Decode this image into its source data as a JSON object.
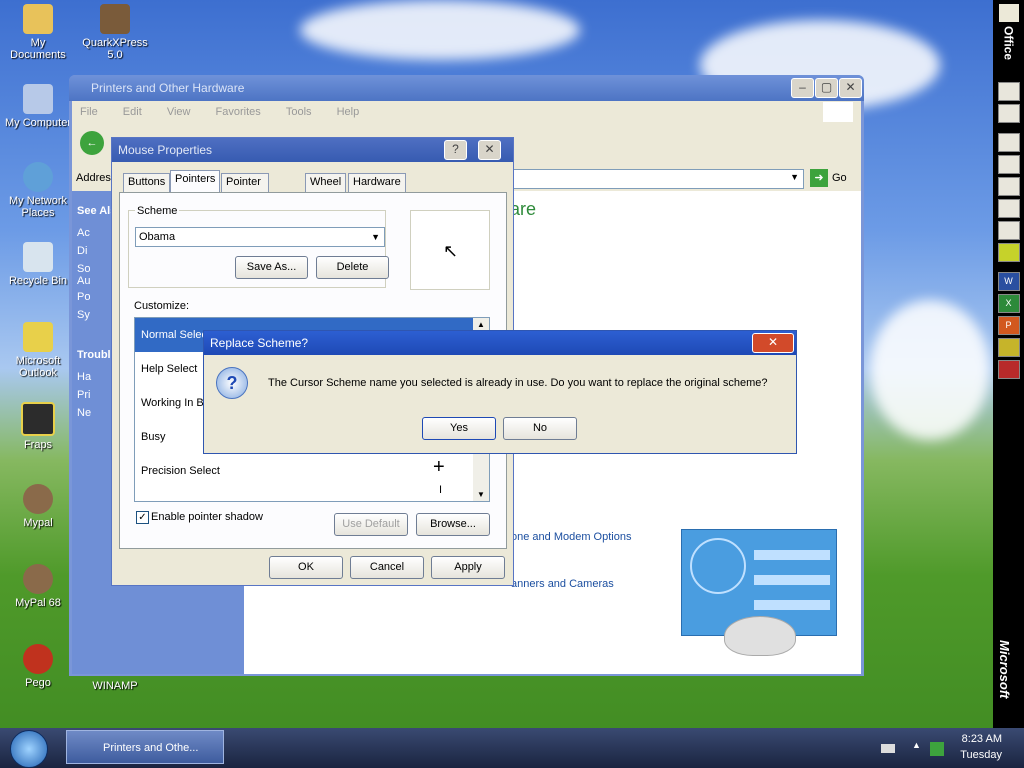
{
  "desktop": {
    "icons": [
      {
        "label": "My Documents"
      },
      {
        "label": "QuarkXPress 5.0"
      },
      {
        "label": "My Computer"
      },
      {
        "label": "My Network Places"
      },
      {
        "label": "Recycle Bin"
      },
      {
        "label": "Microsoft Outlook"
      },
      {
        "label": "Fraps"
      },
      {
        "label": "Mypal"
      },
      {
        "label": "MyPal 68"
      },
      {
        "label": "Pego"
      },
      {
        "label": "WINAMP"
      }
    ]
  },
  "officebar": {
    "label": "Office",
    "brand": "Microsoft"
  },
  "explorer": {
    "title": "Printers and Other Hardware",
    "menu": [
      "File",
      "Edit",
      "View",
      "Favorites",
      "Tools",
      "Help"
    ],
    "address_label": "Address",
    "go_label": "Go",
    "sidebar": {
      "section1": "See Also",
      "items1": [
        "Ac",
        "Di",
        "So",
        "Au",
        "Po",
        "Sy"
      ],
      "section2": "Troubleshooters",
      "items2": [
        "Ha",
        "Pri",
        "Ne"
      ]
    },
    "content": {
      "heading": "are",
      "link1": "one and Modem Options",
      "link2": "anners and Cameras"
    }
  },
  "mouse_dialog": {
    "title": "Mouse Properties",
    "tabs": [
      "Buttons",
      "Pointers",
      "Pointer Options",
      "Wheel",
      "Hardware"
    ],
    "active_tab": "Pointers",
    "scheme_label": "Scheme",
    "scheme_value": "Obama",
    "save_as": "Save As...",
    "delete": "Delete",
    "customize_label": "Customize:",
    "pointers": [
      "Normal Select",
      "Help Select",
      "Working In Background",
      "Busy",
      "Precision Select"
    ],
    "enable_shadow": "Enable pointer shadow",
    "use_default": "Use Default",
    "browse": "Browse...",
    "ok": "OK",
    "cancel": "Cancel",
    "apply": "Apply"
  },
  "replace_dialog": {
    "title": "Replace Scheme?",
    "message": "The Cursor Scheme name you selected is already in use.  Do you want to replace the original scheme?",
    "yes": "Yes",
    "no": "No"
  },
  "taskbar": {
    "task": "Printers and Othe...",
    "time": "8:23 AM",
    "day": "Tuesday"
  }
}
